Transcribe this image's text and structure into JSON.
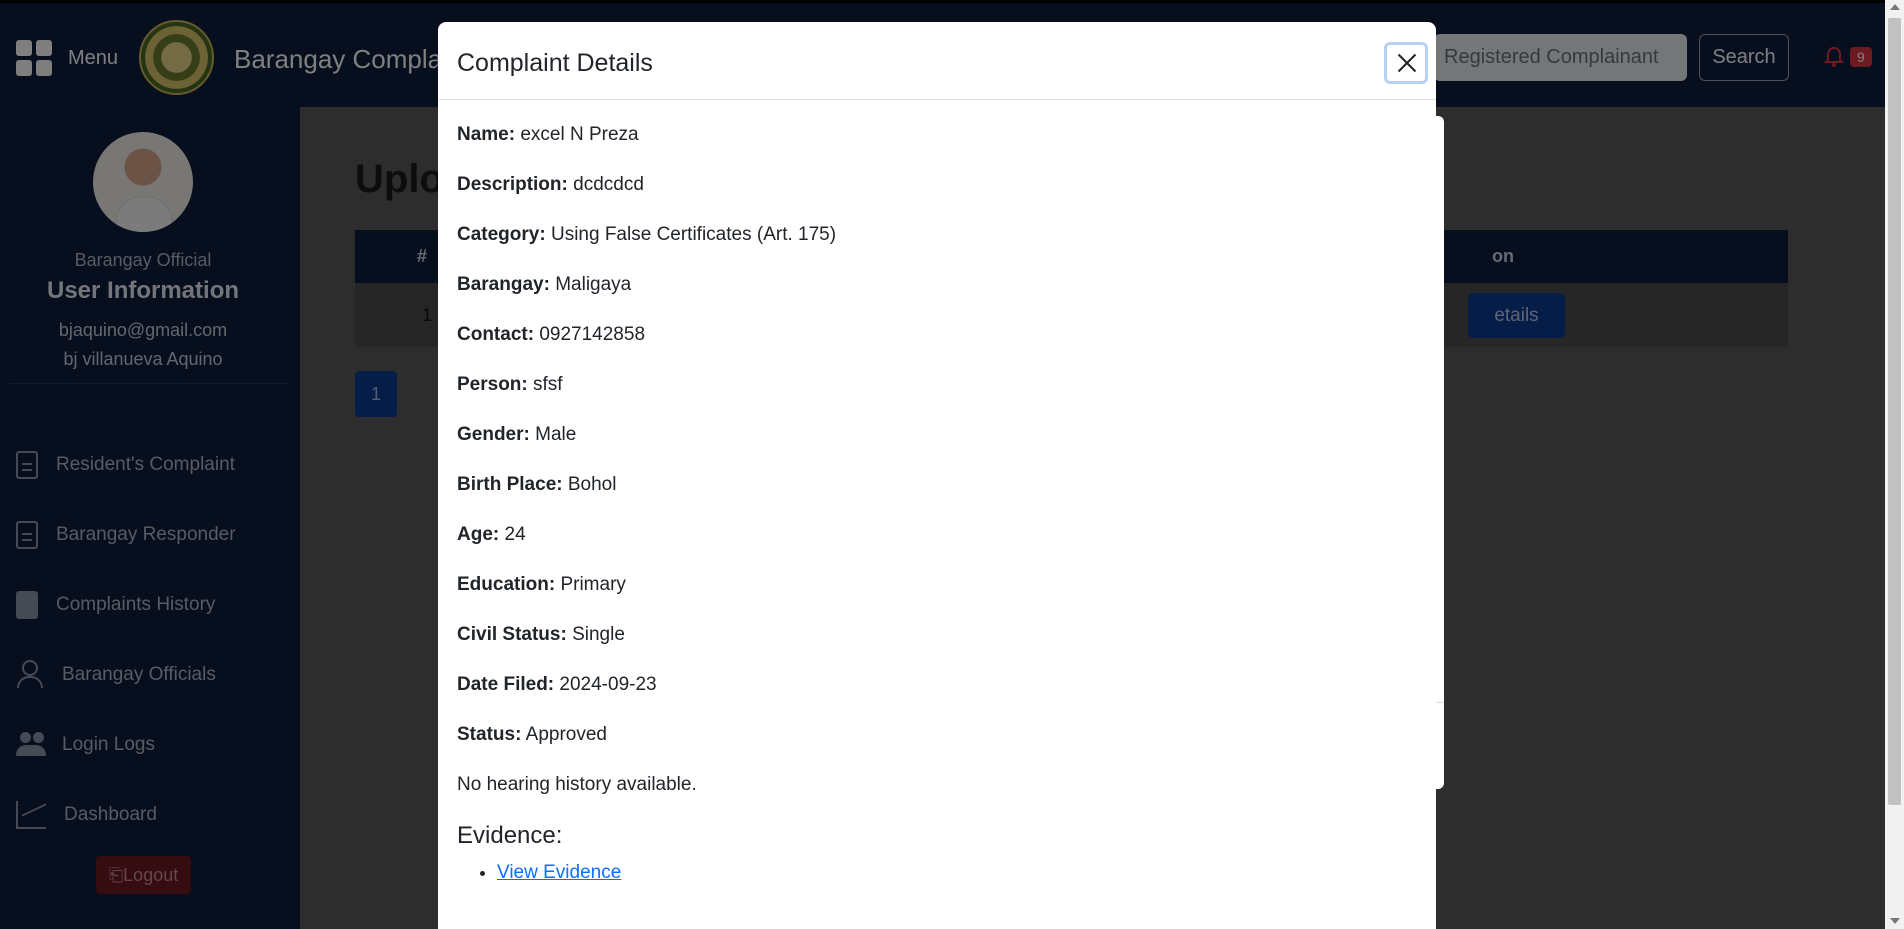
{
  "header": {
    "menu_label": "Menu",
    "brand": "Barangay Complai",
    "search_placeholder": "Registered Complainant",
    "search_button": "Search",
    "notification_count": "9"
  },
  "sidebar": {
    "role": "Barangay Official",
    "info_title": "User Information",
    "email": "bjaquino@gmail.com",
    "name": "bj villanueva Aquino",
    "items": [
      {
        "label": "Resident's Complaint",
        "icon": "document-icon"
      },
      {
        "label": "Barangay Responder",
        "icon": "document-icon"
      },
      {
        "label": "Complaints History",
        "icon": "document-check-icon"
      },
      {
        "label": "Barangay Officials",
        "icon": "person-icon"
      },
      {
        "label": "Login Logs",
        "icon": "people-icon"
      },
      {
        "label": "Dashboard",
        "icon": "chart-line-icon"
      }
    ],
    "logout": "Logout"
  },
  "main": {
    "title": "Uplo",
    "table": {
      "headers": {
        "num": "#",
        "action": "on"
      },
      "rows": [
        {
          "num": "1",
          "action": "etails"
        }
      ]
    },
    "pagination": {
      "current": "1"
    }
  },
  "modal": {
    "title": "Complaint Details",
    "fields": [
      {
        "label": "Name:",
        "value": "excel N Preza"
      },
      {
        "label": "Description:",
        "value": "dcdcdcd"
      },
      {
        "label": "Category:",
        "value": "Using False Certificates (Art. 175)"
      },
      {
        "label": "Barangay:",
        "value": "Maligaya"
      },
      {
        "label": "Contact:",
        "value": "0927142858"
      },
      {
        "label": "Person:",
        "value": "sfsf"
      },
      {
        "label": "Gender:",
        "value": "Male"
      },
      {
        "label": "Birth Place:",
        "value": "Bohol"
      },
      {
        "label": "Age:",
        "value": "24"
      },
      {
        "label": "Education:",
        "value": "Primary"
      },
      {
        "label": "Civil Status:",
        "value": "Single"
      },
      {
        "label": "Date Filed:",
        "value": "2024-09-23"
      },
      {
        "label": "Status:",
        "value": "Approved"
      }
    ],
    "no_history": "No hearing history available.",
    "evidence_heading": "Evidence:",
    "evidence_link": "View Evidence"
  },
  "colors": {
    "navy": "#0e1f3f",
    "primary": "#0d6efd",
    "danger": "#dc3545"
  }
}
